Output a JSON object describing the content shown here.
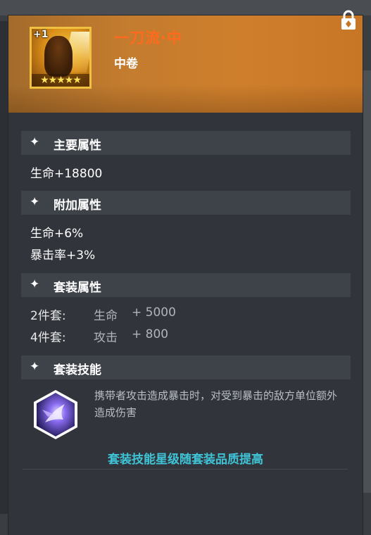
{
  "item": {
    "level_badge": "+1",
    "stars": "★★★★★",
    "name": "一刀流·中",
    "type": "中卷"
  },
  "icons": {
    "lock": "lock-icon",
    "sparkle": "sparkle-icon",
    "skill": "hexagon-skill-icon"
  },
  "colors": {
    "name": "#ff6a1f",
    "footer_note": "#3fc3d6",
    "header": "#cf7f2c"
  },
  "sections": {
    "main": {
      "title": "主要属性",
      "lines": [
        "生命+18800"
      ]
    },
    "extra": {
      "title": "附加属性",
      "lines": [
        "生命+6%",
        "暴击率+3%"
      ]
    },
    "set": {
      "title": "套装属性",
      "rows": [
        {
          "count": "2件套:",
          "stat": "生命",
          "value": "+ 5000"
        },
        {
          "count": "4件套:",
          "stat": "攻击",
          "value": "+ 800"
        }
      ]
    },
    "skill": {
      "title": "套装技能",
      "description": "携带者攻击造成暴击时，对受到暴击的敌方单位额外造成伤害"
    }
  },
  "footer_note": "套装技能星级随套装品质提高"
}
